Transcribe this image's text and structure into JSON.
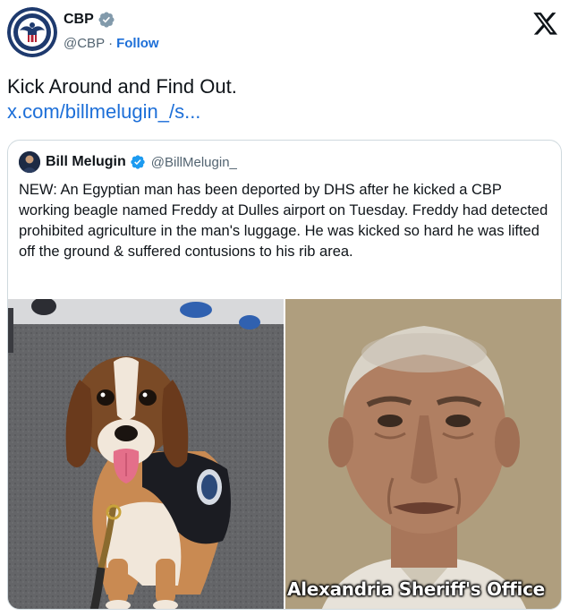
{
  "post": {
    "author": {
      "name": "CBP",
      "handle": "@CBP",
      "separator": "·",
      "follow_label": "Follow",
      "verified_badge": "gray-verified-badge-icon",
      "avatar": "cbp-seal-icon"
    },
    "text": "Kick Around and Find Out.",
    "link": "x.com/billmelugin_/s..."
  },
  "quote": {
    "author": {
      "name": "Bill Melugin",
      "handle": "@BillMelugin_",
      "verified_badge": "blue-verified-badge-icon"
    },
    "text": "NEW: An Egyptian man has been deported by DHS after he kicked a CBP working beagle named Freddy at Dulles airport on Tuesday. Freddy had detected prohibited agriculture in the man's luggage. He was kicked so hard he was lifted off the ground & suffered contusions to his rib area.",
    "photos": {
      "left": "beagle-dog-photo",
      "right": "mugshot-photo",
      "right_watermark": "Alexandria Sheriff's Office"
    }
  },
  "colors": {
    "link": "#1d6fd8",
    "text": "#0f1419",
    "muted": "#536471",
    "border": "#cfd9de",
    "verified_blue": "#1d9bf0",
    "verified_gray": "#829aab"
  },
  "icons": {
    "brand": "x-logo-icon"
  }
}
